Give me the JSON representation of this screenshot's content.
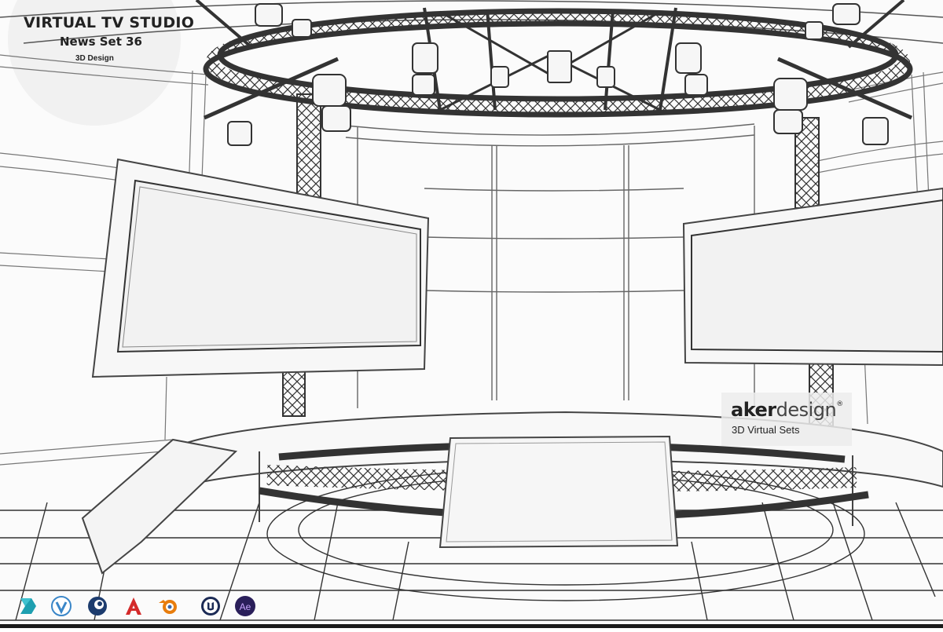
{
  "header": {
    "title": "VIRTUAL TV STUDIO",
    "subtitle": "News Set 36",
    "tagline": "3D Design"
  },
  "brand": {
    "name_bold": "aker",
    "name_regular": "design",
    "registered": "®",
    "tagline": "3D Virtual Sets"
  },
  "software_icons": [
    {
      "name": "3ds-max-icon",
      "color": "#1e9fb0"
    },
    {
      "name": "vue-icon",
      "color": "#3a86c8"
    },
    {
      "name": "cinema4d-icon",
      "color": "#1d3c6e"
    },
    {
      "name": "autocad-icon",
      "color": "#d42a2a"
    },
    {
      "name": "blender-icon",
      "color": "#e87d0d"
    },
    {
      "name": "unreal-engine-icon",
      "color": "#1b2a55"
    },
    {
      "name": "after-effects-icon",
      "color": "#2a1f5a"
    }
  ]
}
